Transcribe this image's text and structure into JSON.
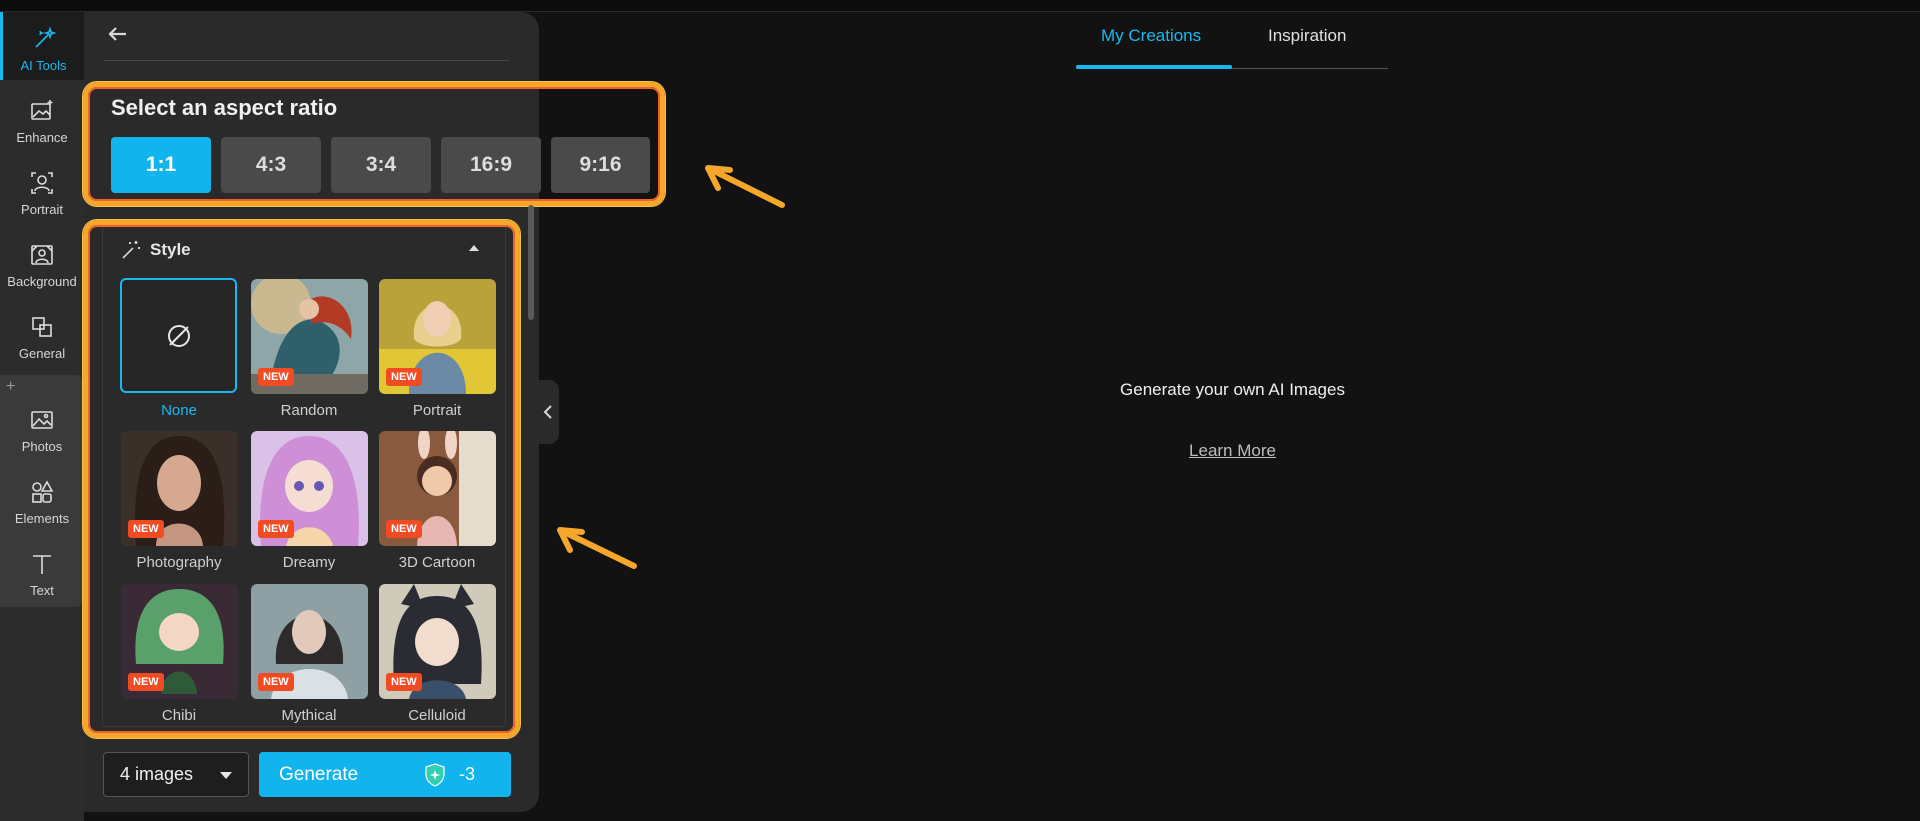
{
  "rail": {
    "items": [
      {
        "label": "AI Tools",
        "icon": "magic-wand-icon"
      },
      {
        "label": "Enhance",
        "icon": "enhance-image-icon"
      },
      {
        "label": "Portrait",
        "icon": "portrait-icon"
      },
      {
        "label": "Background",
        "icon": "background-icon"
      },
      {
        "label": "General",
        "icon": "general-icon"
      },
      {
        "label": "Photos",
        "icon": "photos-icon"
      },
      {
        "label": "Elements",
        "icon": "elements-icon"
      },
      {
        "label": "Text",
        "icon": "text-icon"
      }
    ]
  },
  "aspect": {
    "title": "Select an aspect ratio",
    "options": [
      "1:1",
      "4:3",
      "3:4",
      "16:9",
      "9:16"
    ],
    "selected": "1:1"
  },
  "style": {
    "title": "Style",
    "new_badge": "NEW",
    "tiles": [
      {
        "label": "None",
        "selected": true
      },
      {
        "label": "Random"
      },
      {
        "label": "Portrait"
      },
      {
        "label": "Photography"
      },
      {
        "label": "Dreamy"
      },
      {
        "label": "3D Cartoon"
      },
      {
        "label": "Chibi"
      },
      {
        "label": "Mythical"
      },
      {
        "label": "Celluloid"
      }
    ]
  },
  "footer": {
    "count": "4 images",
    "generate": "Generate",
    "cost": "-3"
  },
  "main": {
    "tabs": [
      "My Creations",
      "Inspiration"
    ],
    "active_tab": "My Creations",
    "empty_text": "Generate your own AI Images",
    "learn_more": "Learn More"
  },
  "colors": {
    "accent": "#12b4ee",
    "highlight": "#f5a62b",
    "badge": "#f04b22"
  }
}
